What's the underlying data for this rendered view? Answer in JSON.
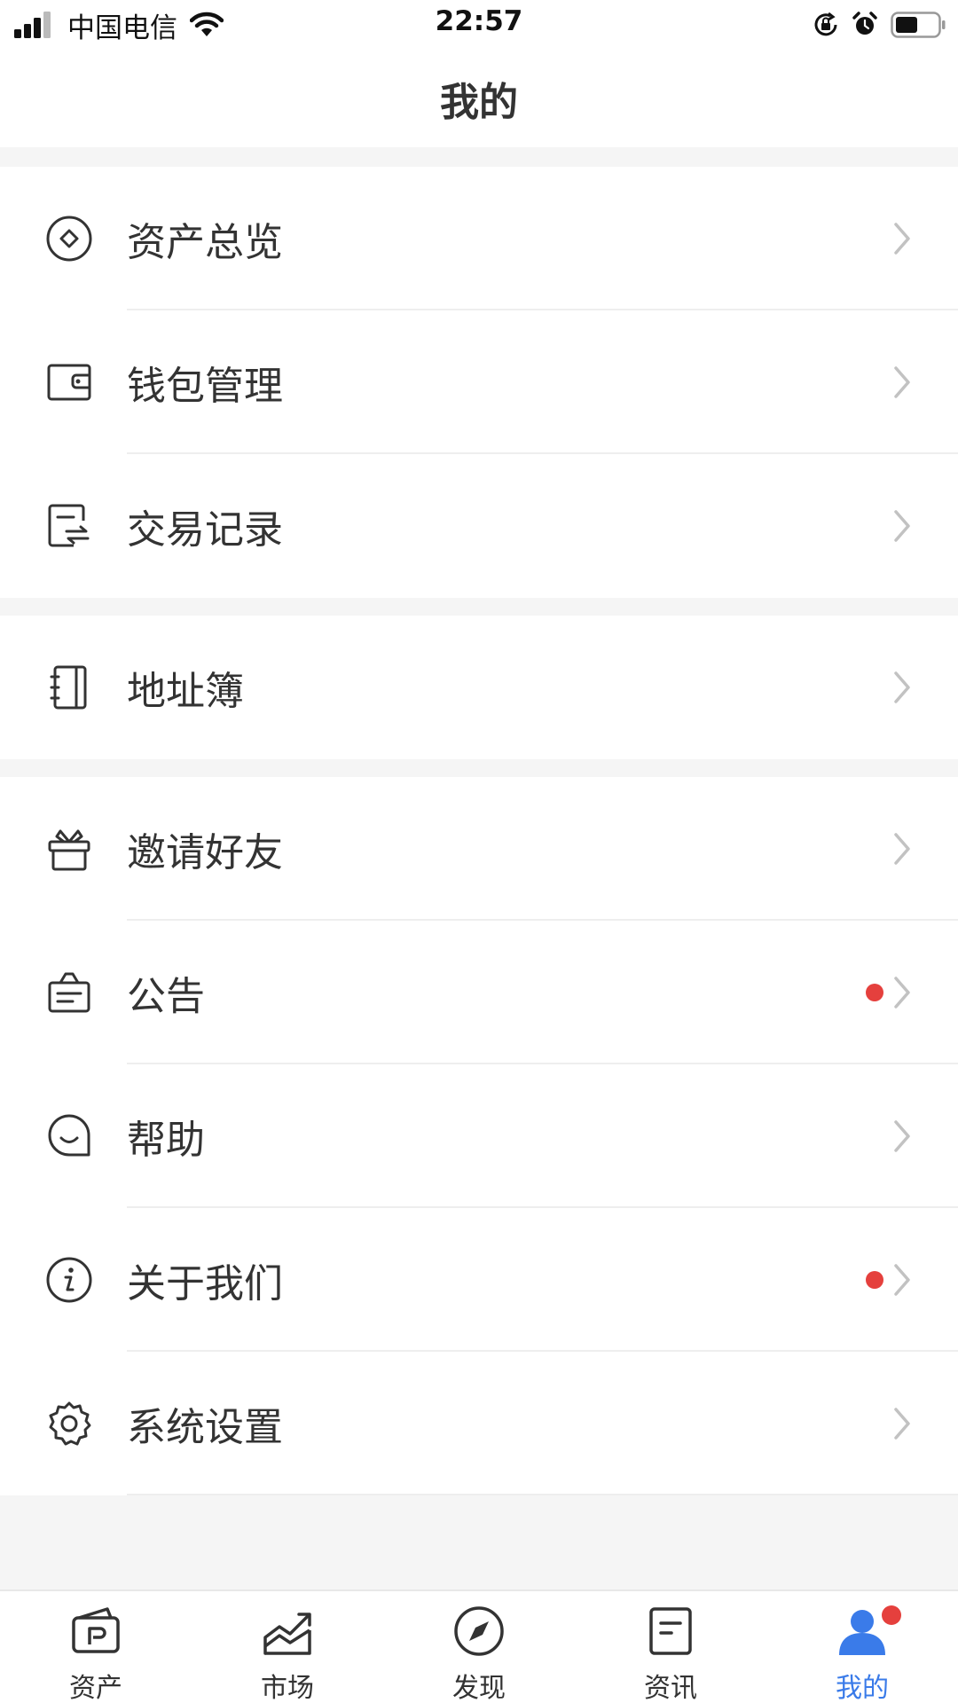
{
  "status_bar": {
    "carrier": "中国电信",
    "time": "22:57"
  },
  "header": {
    "title": "我的"
  },
  "colors": {
    "accent": "#3a7be9",
    "badge": "#e5403d",
    "icon": "#333333",
    "chevron": "#c2c2c2"
  },
  "menu": {
    "group1": [
      {
        "label": "资产总览",
        "icon": "diamond-circle-icon"
      },
      {
        "label": "钱包管理",
        "icon": "wallet-icon"
      },
      {
        "label": "交易记录",
        "icon": "transaction-record-icon"
      }
    ],
    "group2": [
      {
        "label": "地址簿",
        "icon": "address-book-icon"
      }
    ],
    "group3": [
      {
        "label": "邀请好友",
        "icon": "gift-icon"
      },
      {
        "label": "公告",
        "icon": "notice-bag-icon",
        "badge": true
      },
      {
        "label": "帮助",
        "icon": "chat-smile-icon"
      },
      {
        "label": "关于我们",
        "icon": "info-circle-icon",
        "badge": true
      },
      {
        "label": "系统设置",
        "icon": "gear-icon"
      }
    ]
  },
  "tabs": [
    {
      "label": "资产",
      "icon": "wallet-card-icon"
    },
    {
      "label": "市场",
      "icon": "market-chart-icon"
    },
    {
      "label": "发现",
      "icon": "compass-icon"
    },
    {
      "label": "资讯",
      "icon": "news-icon"
    },
    {
      "label": "我的",
      "icon": "user-icon",
      "active": true,
      "badge": true
    }
  ]
}
